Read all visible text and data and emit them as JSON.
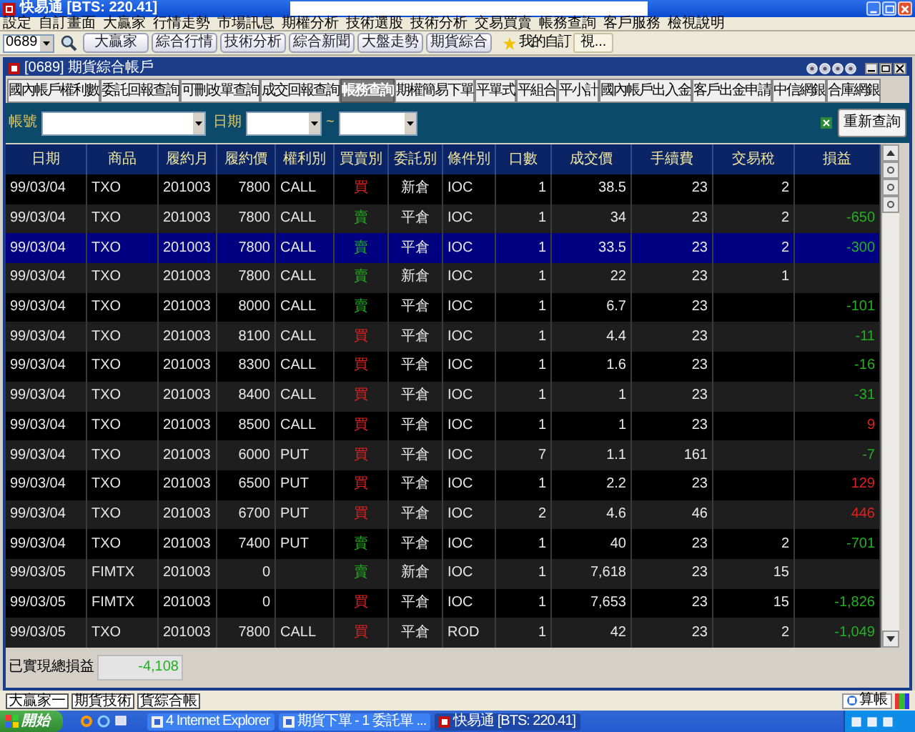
{
  "window": {
    "title": "快易通 [BTS: 220.41]"
  },
  "menu": [
    "設定",
    "自訂畫面",
    "大贏家",
    "行情走勢",
    "市場訊息",
    "期權分析",
    "技術選股",
    "技術分析",
    "交易買賣",
    "帳務查詢",
    "客戶服務",
    "檢視說明"
  ],
  "toolbar": {
    "stock_code": "0689",
    "buttons": [
      "大贏家",
      "綜合行情",
      "技術分析",
      "綜合新聞",
      "大盤走勢",
      "期貨綜合"
    ],
    "favorites": "我的自訂",
    "favorites_button": "視..."
  },
  "child_window": {
    "title": "[0689] 期貨綜合帳戶"
  },
  "tabs": [
    {
      "label": "國內帳戶權利數",
      "selected": false
    },
    {
      "label": "委託回報查詢",
      "selected": false
    },
    {
      "label": "可刪改單查詢",
      "selected": false
    },
    {
      "label": "成交回報查詢",
      "selected": false
    },
    {
      "label": "帳務查詢",
      "selected": true
    },
    {
      "label": "期權簡易下單",
      "selected": false
    },
    {
      "label": "平單式",
      "selected": false
    },
    {
      "label": "平組合",
      "selected": false
    },
    {
      "label": "平小計",
      "selected": false
    },
    {
      "label": "國內帳戶出入金",
      "selected": false
    },
    {
      "label": "客戶出金申請",
      "selected": false
    },
    {
      "label": "中信網銀",
      "selected": false
    },
    {
      "label": "合庫網銀",
      "selected": false
    }
  ],
  "filter": {
    "account_label": "帳號",
    "date_label": "日期",
    "range_separator": "~",
    "requery_button": "重新查詢"
  },
  "table": {
    "columns": [
      "日期",
      "商品",
      "履約月",
      "履約價",
      "權利別",
      "買賣別",
      "委託別",
      "條件別",
      "口數",
      "成交價",
      "手續費",
      "交易稅",
      "損益"
    ],
    "rows": [
      {
        "date": "99/03/04",
        "product": "TXO",
        "month": "201003",
        "strike": "7800",
        "right": "CALL",
        "side": {
          "text": "買",
          "color": "#e02020"
        },
        "order_type": "新倉",
        "condition": "IOC",
        "qty": "1",
        "price": "38.5",
        "fee": "23",
        "tax": "2",
        "selected": false
      },
      {
        "date": "99/03/04",
        "product": "TXO",
        "month": "201003",
        "strike": "7800",
        "right": "CALL",
        "side": {
          "text": "賣",
          "color": "#22b022"
        },
        "order_type": "平倉",
        "condition": "IOC",
        "qty": "1",
        "price": "34",
        "fee": "23",
        "tax": "2",
        "pnl": {
          "text": "-650",
          "color": "#22b022"
        },
        "selected": false
      },
      {
        "date": "99/03/04",
        "product": "TXO",
        "month": "201003",
        "strike": "7800",
        "right": "CALL",
        "side": {
          "text": "賣",
          "color": "#22b022"
        },
        "order_type": "平倉",
        "condition": "IOC",
        "qty": "1",
        "price": "33.5",
        "fee": "23",
        "tax": "2",
        "pnl": {
          "text": "-300",
          "color": "#22b022"
        },
        "selected": true
      },
      {
        "date": "99/03/04",
        "product": "TXO",
        "month": "201003",
        "strike": "7800",
        "right": "CALL",
        "side": {
          "text": "賣",
          "color": "#22b022"
        },
        "order_type": "新倉",
        "condition": "IOC",
        "qty": "1",
        "price": "22",
        "fee": "23",
        "tax": "1",
        "selected": false
      },
      {
        "date": "99/03/04",
        "product": "TXO",
        "month": "201003",
        "strike": "8000",
        "right": "CALL",
        "side": {
          "text": "賣",
          "color": "#22b022"
        },
        "order_type": "平倉",
        "condition": "IOC",
        "qty": "1",
        "price": "6.7",
        "fee": "23",
        "pnl": {
          "text": "-101",
          "color": "#22b022"
        },
        "selected": false
      },
      {
        "date": "99/03/04",
        "product": "TXO",
        "month": "201003",
        "strike": "8100",
        "right": "CALL",
        "side": {
          "text": "買",
          "color": "#e02020"
        },
        "order_type": "平倉",
        "condition": "IOC",
        "qty": "1",
        "price": "4.4",
        "fee": "23",
        "pnl": {
          "text": "-11",
          "color": "#22b022"
        },
        "selected": false
      },
      {
        "date": "99/03/04",
        "product": "TXO",
        "month": "201003",
        "strike": "8300",
        "right": "CALL",
        "side": {
          "text": "買",
          "color": "#e02020"
        },
        "order_type": "平倉",
        "condition": "IOC",
        "qty": "1",
        "price": "1.6",
        "fee": "23",
        "pnl": {
          "text": "-16",
          "color": "#22b022"
        },
        "selected": false
      },
      {
        "date": "99/03/04",
        "product": "TXO",
        "month": "201003",
        "strike": "8400",
        "right": "CALL",
        "side": {
          "text": "買",
          "color": "#e02020"
        },
        "order_type": "平倉",
        "condition": "IOC",
        "qty": "1",
        "price": "1",
        "fee": "23",
        "pnl": {
          "text": "-31",
          "color": "#22b022"
        },
        "selected": false
      },
      {
        "date": "99/03/04",
        "product": "TXO",
        "month": "201003",
        "strike": "8500",
        "right": "CALL",
        "side": {
          "text": "買",
          "color": "#e02020"
        },
        "order_type": "平倉",
        "condition": "IOC",
        "qty": "1",
        "price": "1",
        "fee": "23",
        "pnl": {
          "text": "9",
          "color": "#e02020"
        },
        "selected": false
      },
      {
        "date": "99/03/04",
        "product": "TXO",
        "month": "201003",
        "strike": "6000",
        "right": "PUT",
        "side": {
          "text": "買",
          "color": "#e02020"
        },
        "order_type": "平倉",
        "condition": "IOC",
        "qty": "7",
        "price": "1.1",
        "fee": "161",
        "pnl": {
          "text": "-7",
          "color": "#22b022"
        },
        "selected": false
      },
      {
        "date": "99/03/04",
        "product": "TXO",
        "month": "201003",
        "strike": "6500",
        "right": "PUT",
        "side": {
          "text": "買",
          "color": "#e02020"
        },
        "order_type": "平倉",
        "condition": "IOC",
        "qty": "1",
        "price": "2.2",
        "fee": "23",
        "pnl": {
          "text": "129",
          "color": "#e02020"
        },
        "selected": false
      },
      {
        "date": "99/03/04",
        "product": "TXO",
        "month": "201003",
        "strike": "6700",
        "right": "PUT",
        "side": {
          "text": "買",
          "color": "#e02020"
        },
        "order_type": "平倉",
        "condition": "IOC",
        "qty": "2",
        "price": "4.6",
        "fee": "46",
        "pnl": {
          "text": "446",
          "color": "#e02020"
        },
        "selected": false
      },
      {
        "date": "99/03/04",
        "product": "TXO",
        "month": "201003",
        "strike": "7400",
        "right": "PUT",
        "side": {
          "text": "賣",
          "color": "#22b022"
        },
        "order_type": "平倉",
        "condition": "IOC",
        "qty": "1",
        "price": "40",
        "fee": "23",
        "tax": "2",
        "pnl": {
          "text": "-701",
          "color": "#22b022"
        },
        "selected": false
      },
      {
        "date": "99/03/05",
        "product": "FIMTX",
        "month": "201003",
        "strike": "0",
        "side": {
          "text": "賣",
          "color": "#22b022"
        },
        "order_type": "新倉",
        "condition": "IOC",
        "qty": "1",
        "price": "7,618",
        "fee": "23",
        "tax": "15",
        "selected": false
      },
      {
        "date": "99/03/05",
        "product": "FIMTX",
        "month": "201003",
        "strike": "0",
        "side": {
          "text": "買",
          "color": "#e02020"
        },
        "order_type": "平倉",
        "condition": "IOC",
        "qty": "1",
        "price": "7,653",
        "fee": "23",
        "tax": "15",
        "pnl": {
          "text": "-1,826",
          "color": "#22b022"
        },
        "selected": false
      },
      {
        "date": "99/03/05",
        "product": "TXO",
        "month": "201003",
        "strike": "7800",
        "right": "CALL",
        "side": {
          "text": "買",
          "color": "#e02020"
        },
        "order_type": "平倉",
        "condition": "ROD",
        "qty": "1",
        "price": "42",
        "fee": "23",
        "tax": "2",
        "pnl": {
          "text": "-1,049",
          "color": "#22b022"
        },
        "selected": false
      }
    ]
  },
  "total": {
    "label": "已實現總損益",
    "value": "-4,108"
  },
  "bottom_tabs": [
    "大贏家一",
    "期貨技術",
    "貨綜合帳"
  ],
  "bottom_right_button": "算帳",
  "taskbar": {
    "start": "開始",
    "items": [
      {
        "label": "4 Internet Explorer",
        "selected": false
      },
      {
        "label": "期貨下單 - 1 委託單 ...",
        "selected": false
      },
      {
        "label": "快易通 [BTS: 220.41]",
        "selected": true
      }
    ]
  }
}
